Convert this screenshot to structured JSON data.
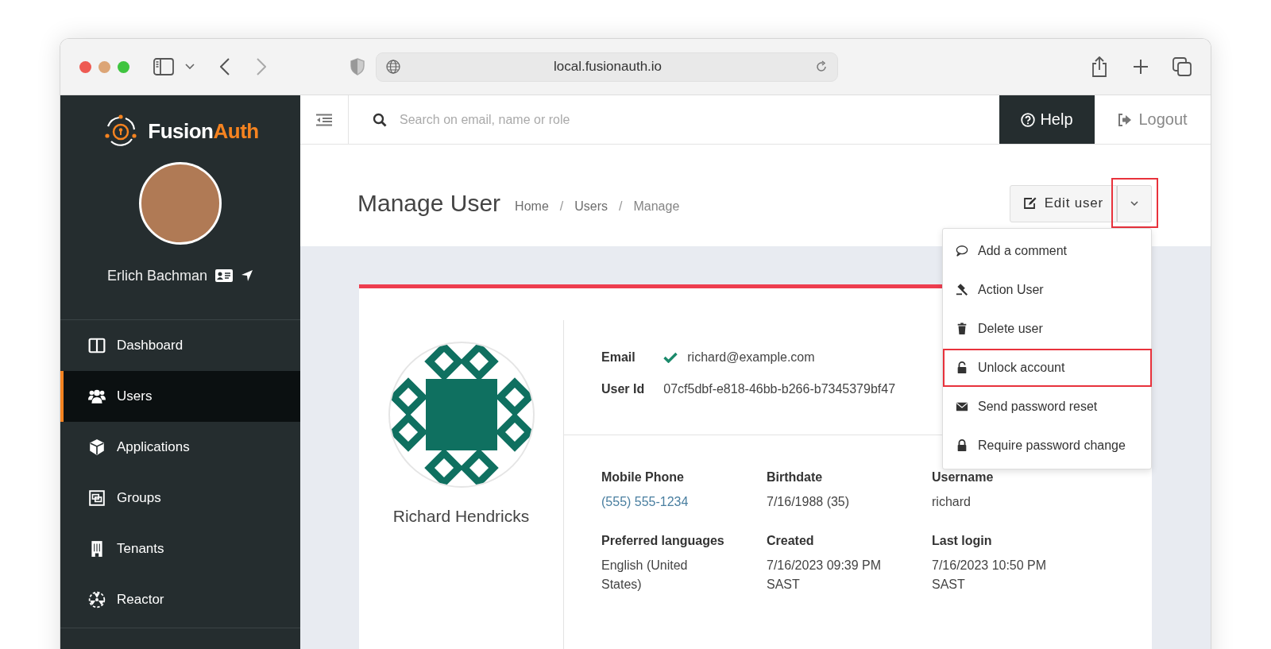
{
  "browser": {
    "url": "local.fusionauth.io"
  },
  "sidebar": {
    "brand": {
      "part_1": "Fusion",
      "part_2": "Auth"
    },
    "user_name": "Erlich Bachman",
    "nav": [
      {
        "label": "Dashboard",
        "selected": false
      },
      {
        "label": "Users",
        "selected": true
      },
      {
        "label": "Applications",
        "selected": false
      },
      {
        "label": "Groups",
        "selected": false
      },
      {
        "label": "Tenants",
        "selected": false
      },
      {
        "label": "Reactor",
        "selected": false
      }
    ]
  },
  "topbar": {
    "search_placeholder": "Search on email, name or role",
    "help": "Help",
    "logout": "Logout"
  },
  "header": {
    "title": "Manage User",
    "breadcrumbs": [
      {
        "text": "Home",
        "kind": "link"
      },
      {
        "text": "/",
        "kind": "separator"
      },
      {
        "text": "Users",
        "kind": "link"
      },
      {
        "text": "/",
        "kind": "separator"
      },
      {
        "text": "Manage",
        "kind": "current"
      }
    ],
    "edit_button": "Edit user",
    "dropdown_toggle": {
      "highlighted": true
    }
  },
  "menu": [
    {
      "label": "Add a comment",
      "highlighted": false
    },
    {
      "label": "Action User",
      "highlighted": false
    },
    {
      "label": "Delete user",
      "highlighted": false
    },
    {
      "label": "Unlock account",
      "highlighted": true
    },
    {
      "label": "Send password reset",
      "highlighted": false
    },
    {
      "label": "Require password change",
      "highlighted": false
    }
  ],
  "user": {
    "name": "Richard Hendricks",
    "email_label": "Email",
    "email": "richard@example.com",
    "email_verified": true,
    "user_id_label": "User Id",
    "user_id": "07cf5dbf-e818-46bb-b266-b7345379bf47",
    "fields": [
      {
        "label": "Mobile Phone",
        "value": "(555) 555-1234",
        "kind": "link"
      },
      {
        "label": "Birthdate",
        "value": "7/16/1988 (35)",
        "kind": "text"
      },
      {
        "label": "Username",
        "value": "richard",
        "kind": "text"
      },
      {
        "label": "Preferred languages",
        "value": "English (United States)",
        "kind": "text"
      },
      {
        "label": "Created",
        "value": "7/16/2023 09:39 PM SAST",
        "kind": "text"
      },
      {
        "label": "Last login",
        "value": "7/16/2023 10:50 PM SAST",
        "kind": "text"
      }
    ]
  }
}
